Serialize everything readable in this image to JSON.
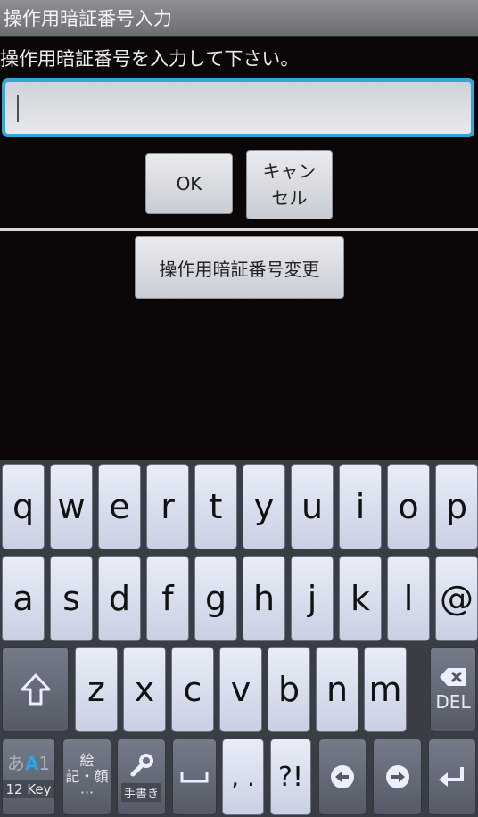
{
  "dialog": {
    "title": "操作用暗証番号入力",
    "prompt": "操作用暗証番号を入力して下さい。",
    "input_value": "",
    "ok_label": "OK",
    "cancel_label": "キャン\nセル",
    "change_label": "操作用暗証番号変更"
  },
  "keyboard": {
    "row1": [
      "q",
      "w",
      "e",
      "r",
      "t",
      "y",
      "u",
      "i",
      "o",
      "p"
    ],
    "row2": [
      "a",
      "s",
      "d",
      "f",
      "g",
      "h",
      "j",
      "k",
      "l",
      "@"
    ],
    "row3": [
      "z",
      "x",
      "c",
      "v",
      "b",
      "n",
      "m"
    ],
    "shift_icon": "shift-arrow-icon",
    "delete": {
      "icon": "backspace-x-icon",
      "label": "DEL"
    },
    "mode": {
      "kana": "あ",
      "alpha": "A",
      "num": "1",
      "label": "12 Key"
    },
    "emoji": {
      "line1": "絵",
      "line2": "記・顔",
      "dots": "···"
    },
    "handwriting": {
      "icon": "wrench-icon",
      "label": "手書き"
    },
    "space_icon": "space-bracket-icon",
    "comma_period": ", .",
    "symbols": "?!",
    "left_icon": "left-arrow-icon",
    "right_icon": "right-arrow-icon",
    "enter_icon": "enter-arrow-icon",
    "accent_color": "#2aa6e8"
  }
}
